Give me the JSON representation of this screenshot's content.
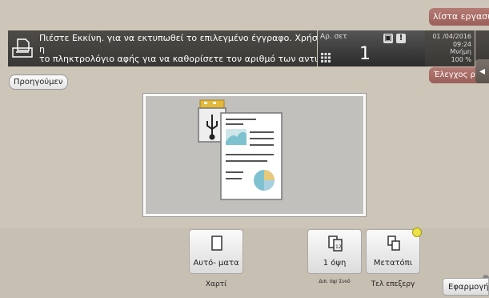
{
  "header": {
    "job_list_label": "λίστα εργασιών",
    "message_line1": "Πιέστε Εκκίνη. για να εκτυπωθεί το επιλεγμένο έγγραφο. Χρήσ",
    "message_line2": "η",
    "message_line3": "το πληκτρολόγιο αφής για να καθορίσετε τον αριθμό των αντιγ",
    "copies_label": "Αρ. σετ",
    "copies_value": "1",
    "date": "01 /04/2016",
    "time": "09:24",
    "memory_label": "Μνήμη",
    "memory_value": "100 %",
    "check_label": "Έλεγχος ρ"
  },
  "nav": {
    "previous_label": "Προηγούμεν"
  },
  "functions": {
    "paper": {
      "label": "Αυτό- ματα",
      "sub": "Χαρτί"
    },
    "duplex": {
      "label": "1 όψη",
      "sub": "Διπ. όψ/ Συνδ"
    },
    "finishing": {
      "label": "Μετατόπι",
      "sub": "Τελ επεξεργ"
    }
  },
  "footer": {
    "apply_label": "Εφαρμογή"
  },
  "icons": {
    "document": "document-icon",
    "keypad": "keypad-icon",
    "usb": "usb-icon",
    "paper": "paper-icon",
    "duplex": "duplex-icon",
    "finishing": "offset-icon"
  },
  "colors": {
    "accent": "#a86a63",
    "background": "#cdc5b8",
    "bar": "#3f3d3a"
  }
}
